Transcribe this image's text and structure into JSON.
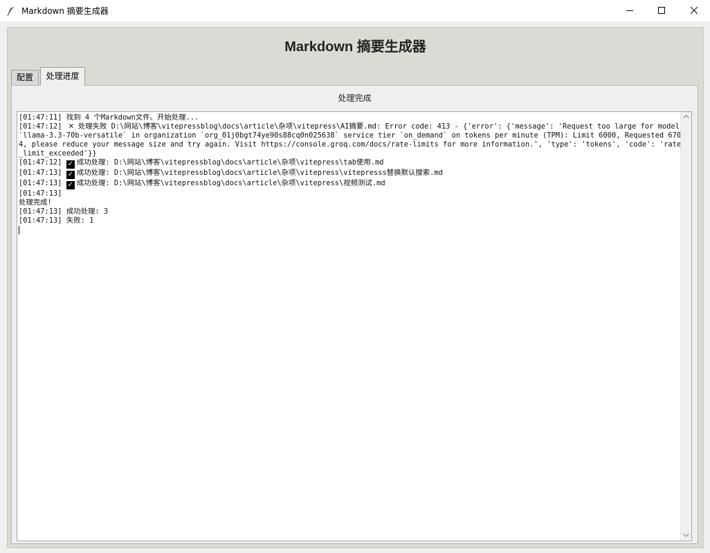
{
  "window": {
    "title": "Markdown 摘要生成器",
    "icon": "feather-icon",
    "controls": [
      "minimize-icon",
      "maximize-icon",
      "close-icon"
    ]
  },
  "header": {
    "title": "Markdown 摘要生成器"
  },
  "tabs": [
    {
      "label": "配置",
      "active": false
    },
    {
      "label": "处理进度",
      "active": true
    }
  ],
  "progress": {
    "status": "处理完成"
  },
  "log": [
    {
      "ts": "[01:47:11]",
      "icon": "",
      "text": " 找到 4 个Markdown文件。开始处理..."
    },
    {
      "ts": "[01:47:12]",
      "icon": "cross",
      "text": "处理失败 D:\\网站\\博客\\vitepressblog\\docs\\article\\杂项\\vitepress\\AI摘要.md: Error code: 413 - {'error': {'message': 'Request too large for model `llama-3.3-70b-versatile` in organization `org_01j0bgt74ye90s88cq0n025638` service tier `on_demand` on tokens per minute (TPM): Limit 6000, Requested 6704, please reduce your message size and try again. Visit https://console.groq.com/docs/rate-limits for more information.', 'type': 'tokens', 'code': 'rate_limit_exceeded'}}"
    },
    {
      "ts": "[01:47:12]",
      "icon": "check",
      "text": "成功处理: D:\\网站\\博客\\vitepressblog\\docs\\article\\杂项\\vitepress\\tab使用.md"
    },
    {
      "ts": "[01:47:13]",
      "icon": "check",
      "text": "成功处理: D:\\网站\\博客\\vitepressblog\\docs\\article\\杂项\\vitepress\\vitepresss替换默认搜索.md"
    },
    {
      "ts": "[01:47:13]",
      "icon": "check",
      "text": "成功处理: D:\\网站\\博客\\vitepressblog\\docs\\article\\杂项\\vitepress\\视频测试.md"
    },
    {
      "ts": "[01:47:13]",
      "icon": "",
      "text": ""
    },
    {
      "ts": "",
      "icon": "",
      "text": "处理完成!"
    },
    {
      "ts": "[01:47:13]",
      "icon": "",
      "text": " 成功处理: 3"
    },
    {
      "ts": "[01:47:13]",
      "icon": "",
      "text": " 失败: 1"
    }
  ]
}
